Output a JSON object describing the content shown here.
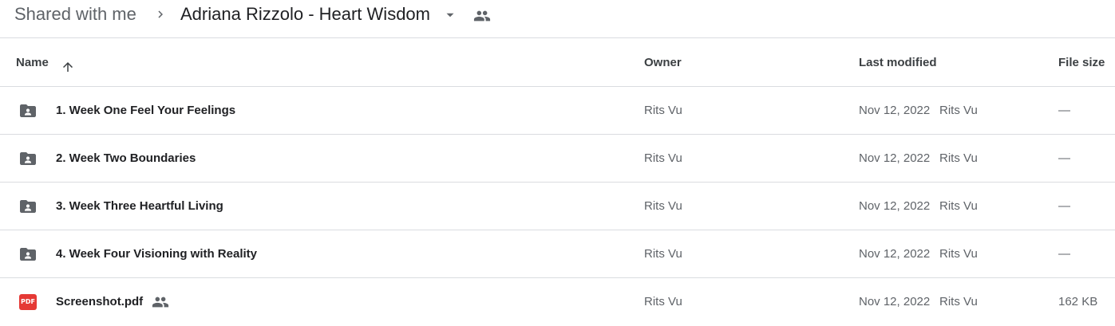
{
  "breadcrumb": {
    "root": "Shared with me",
    "current": "Adriana Rizzolo - Heart Wisdom"
  },
  "columns": {
    "name": "Name",
    "owner": "Owner",
    "last_modified": "Last modified",
    "file_size": "File size"
  },
  "files": [
    {
      "name": "1. Week One Feel Your Feelings",
      "type": "shared-folder",
      "owner": "Rits Vu",
      "modified_date": "Nov 12, 2022",
      "modified_by": "Rits Vu",
      "size": "—"
    },
    {
      "name": "2. Week Two Boundaries",
      "type": "shared-folder",
      "owner": "Rits Vu",
      "modified_date": "Nov 12, 2022",
      "modified_by": "Rits Vu",
      "size": "—"
    },
    {
      "name": "3. Week Three Heartful Living",
      "type": "shared-folder",
      "owner": "Rits Vu",
      "modified_date": "Nov 12, 2022",
      "modified_by": "Rits Vu",
      "size": "—"
    },
    {
      "name": "4. Week Four Visioning with Reality",
      "type": "shared-folder",
      "owner": "Rits Vu",
      "modified_date": "Nov 12, 2022",
      "modified_by": "Rits Vu",
      "size": "—"
    },
    {
      "name": "Screenshot.pdf",
      "type": "pdf",
      "badge": "PDF",
      "shared": true,
      "owner": "Rits Vu",
      "modified_date": "Nov 12, 2022",
      "modified_by": "Rits Vu",
      "size": "162 KB"
    }
  ],
  "colors": {
    "folder": "#5f6368",
    "pdf": "#e53935",
    "divider": "#dadce0"
  }
}
